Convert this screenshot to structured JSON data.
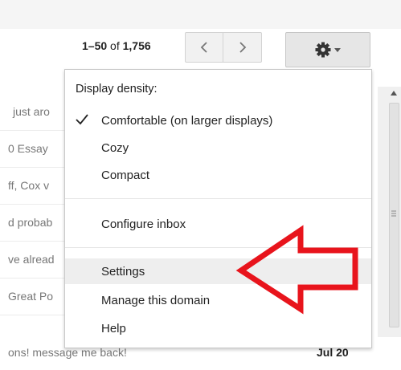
{
  "toolbar": {
    "range": "1–50",
    "of": "of",
    "total": "1,756",
    "prev_icon": "chevron-left-icon",
    "next_icon": "chevron-right-icon",
    "settings_icon": "gear-icon"
  },
  "mail_snippets": [
    "just aro",
    "0 Essay",
    "ff, Cox v",
    "d probab",
    "ve alread",
    "Great Po"
  ],
  "bottom_row": {
    "snippet": "ons! message me back!",
    "date": "Jul 20"
  },
  "menu": {
    "header": "Display density:",
    "density_options": [
      {
        "label": "Comfortable (on larger displays)",
        "checked": true
      },
      {
        "label": "Cozy",
        "checked": false
      },
      {
        "label": "Compact",
        "checked": false
      }
    ],
    "configure_inbox": "Configure inbox",
    "settings": "Settings",
    "manage_domain": "Manage this domain",
    "help": "Help"
  },
  "colors": {
    "arrow": "#e8141c",
    "hover": "#eeeeee"
  }
}
